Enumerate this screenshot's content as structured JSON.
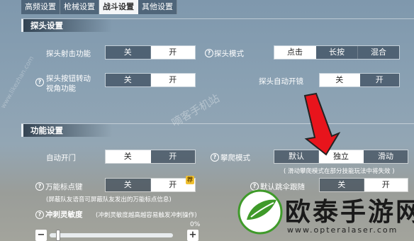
{
  "tabs": [
    {
      "label": "高频设置",
      "active": false
    },
    {
      "label": "枪械设置",
      "active": false
    },
    {
      "label": "战斗设置",
      "active": true
    },
    {
      "label": "其他设置",
      "active": false
    }
  ],
  "sections": {
    "peek": {
      "title": "探头设置"
    },
    "function": {
      "title": "功能设置"
    }
  },
  "peek_fire": {
    "label": "探头射击功能",
    "options": [
      "关",
      "开"
    ],
    "selected": "开"
  },
  "peek_mode": {
    "label": "探头模式",
    "options": [
      "点击",
      "长按",
      "混合"
    ],
    "selected": "点击"
  },
  "peek_view": {
    "label_line1": "探头按钮转动",
    "label_line2": "视角功能",
    "options": [
      "关",
      "开"
    ],
    "selected": "开"
  },
  "peek_scope": {
    "label": "探头自动开镜",
    "options": [
      "关",
      "开"
    ],
    "selected": "关"
  },
  "auto_door": {
    "label": "自动开门",
    "options": [
      "关",
      "开"
    ],
    "selected": "关"
  },
  "climb_mode": {
    "label": "攀爬模式",
    "options": [
      "默认",
      "独立",
      "滑动"
    ],
    "selected": "独立",
    "note": "( 滑动攀爬模式在部分技能玩法中将失效 )"
  },
  "marker_key": {
    "label": "万能标点键",
    "options": [
      "关",
      "开"
    ],
    "selected": "开",
    "badge": "荐",
    "note": "(屏蔽队友语音可屏蔽队友发出的万能标点信息)"
  },
  "parachute": {
    "label": "默认跳伞跟随",
    "options": [
      "关",
      "开"
    ],
    "selected": "开"
  },
  "sprint": {
    "label": "冲刺灵敏度",
    "note": "(冲刺灵敏度越高越容易触发冲刺操作)",
    "value_text": "0%",
    "minus": "−",
    "plus": "+",
    "value": 0.05
  },
  "watermarks": {
    "diag": "嘀客手机站",
    "side": "www.likezhan.com"
  },
  "brand": {
    "name": "欧泰手游网",
    "url": "www.opteralaser.com"
  },
  "colors": {
    "arrow": "#e8141c",
    "logo_green": "#3f9a2a"
  }
}
